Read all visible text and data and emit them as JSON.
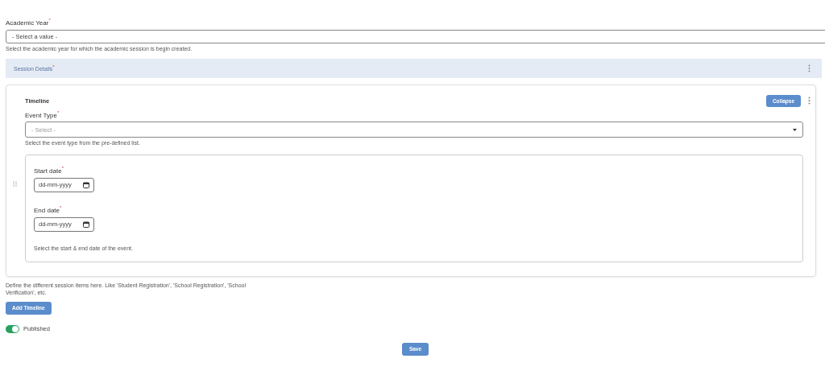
{
  "academic_year": {
    "label": "Academic Year$^{*}$",
    "placeholder": "- Select a value -",
    "help": "Select the academic year for which the academic session is begin created."
  },
  "session_details": {
    "title": "Session Details$^{*}$"
  },
  "timeline": {
    "title": "Timeline",
    "collapse_button": "Collapse",
    "event_type": {
      "label": "Event Type$^{*}$",
      "placeholder": "- Select -",
      "help": "Select the event type from the pre-defined list."
    },
    "start_date": {
      "label": "Start date$^{*}$",
      "placeholder": "dd-mm-yyyy"
    },
    "end_date": {
      "label": "End date$^{*}$",
      "placeholder": "dd-mm-yyyy"
    },
    "date_help": "Select the start & end date of the event."
  },
  "timeline_help": "Define the different session items here. Like 'Student Registration', 'School Registration', 'School Verification', etc.",
  "add_button": "Add Timeline",
  "published": {
    "label": "Published",
    "on": true
  },
  "save_button": "Save"
}
